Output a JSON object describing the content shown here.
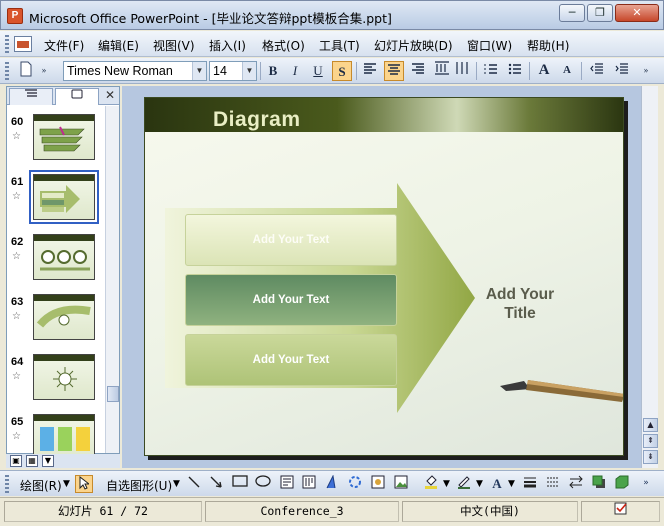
{
  "window": {
    "app_icon_label": "P",
    "title": "Microsoft Office PowerPoint - [毕业论文答辩ppt模板合集.ppt]",
    "minimize_label": "─",
    "restore_label": "❐",
    "close_label": "✕"
  },
  "menu": {
    "items": [
      "文件(F)",
      "编辑(E)",
      "视图(V)",
      "插入(I)",
      "格式(O)",
      "工具(T)",
      "幻灯片放映(D)",
      "窗口(W)",
      "帮助(H)"
    ]
  },
  "format_toolbar": {
    "font_name": "Times New Roman",
    "font_size": "14",
    "bold": "B",
    "italic": "I",
    "underline": "U",
    "shadow": "S",
    "grow_font": "A",
    "shrink_font": "A"
  },
  "slides_pane": {
    "close_label": "✕",
    "thumbnails": [
      {
        "number": "60"
      },
      {
        "number": "61"
      },
      {
        "number": "62"
      },
      {
        "number": "63"
      },
      {
        "number": "64"
      },
      {
        "number": "65"
      }
    ],
    "star_glyph": "☆",
    "selected_number": "61"
  },
  "slide": {
    "title": "Diagram",
    "box1": "Add Your Text",
    "box2": "Add Your Text",
    "box3": "Add Your Text",
    "side_title": "Add Your Title"
  },
  "draw_toolbar": {
    "draw_label": "绘图(R)",
    "autoshapes_label": "自选图形(U)"
  },
  "status": {
    "slide_indicator": "幻灯片 61 / 72",
    "design_name": "Conference_3",
    "language": "中文(中国)"
  },
  "colors": {
    "slide_header": "#2a3510",
    "selected_thumb_border": "#3160c4",
    "active_toolbar_button": "#fbd48c"
  }
}
